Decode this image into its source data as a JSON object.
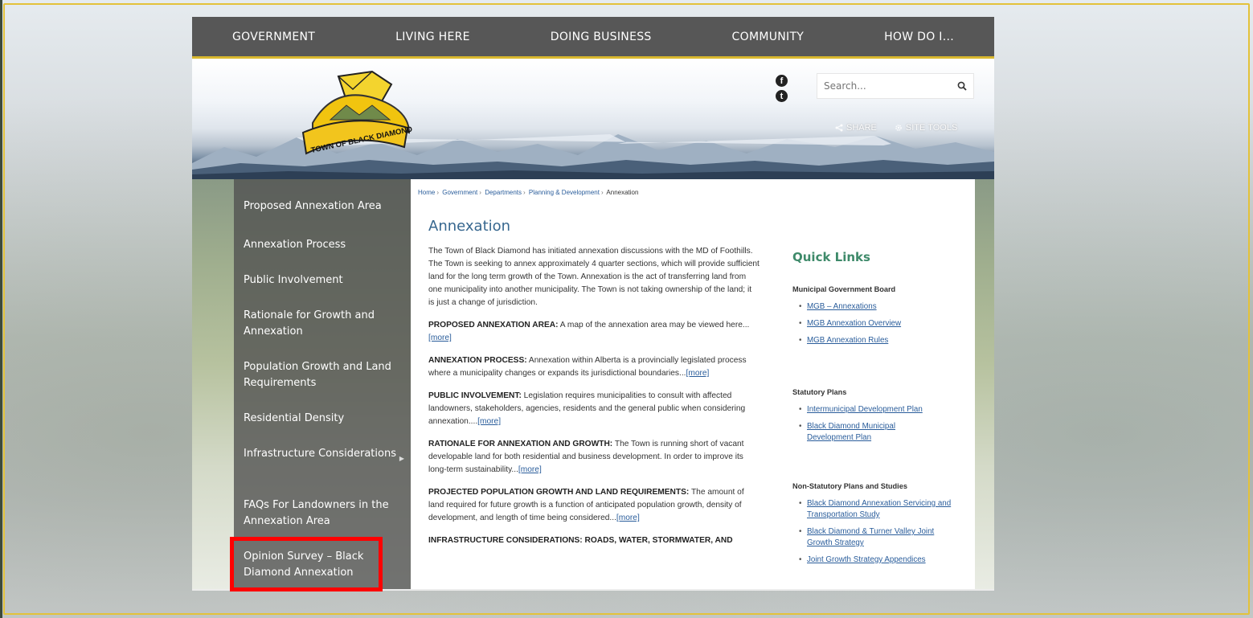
{
  "topnav": {
    "items": [
      "GOVERNMENT",
      "LIVING HERE",
      "DOING BUSINESS",
      "COMMUNITY",
      "HOW DO I..."
    ]
  },
  "header": {
    "logo_text": "TOWN OF BLACK DIAMOND",
    "search_placeholder": "Search...",
    "share_label": "SHARE",
    "site_tools_label": "SITE TOOLS"
  },
  "sidenav": {
    "items": [
      "Proposed Annexation Area",
      "Annexation Process",
      "Public Involvement",
      "Rationale for Growth and Annexation",
      "Population Growth and Land Requirements",
      "Residential Density",
      "Infrastructure Considerations",
      "FAQs For Landowners in the Annexation Area",
      "Opinion Survey – Black Diamond Annexation"
    ]
  },
  "breadcrumb": [
    "Home",
    "Government",
    "Departments",
    "Planning & Development",
    "Annexation"
  ],
  "main": {
    "title": "Annexation",
    "intro": "The Town of Black Diamond has initiated annexation discussions with the MD of Foothills. The Town is seeking to annex approximately 4 quarter sections, which will provide sufficient land for the long term growth of the Town. Annexation is the act of transferring land from one municipality into another municipality. The Town is not taking ownership of the land; it is just a change of jurisdiction.",
    "more": "[more]",
    "sections": [
      {
        "heading": "PROPOSED ANNEXATION AREA:",
        "text": " A map of the annexation area may be viewed here..."
      },
      {
        "heading": "ANNEXATION PROCESS:",
        "text": " Annexation within Alberta is a provincially legislated process where a municipality changes or expands its jurisdictional boundaries..."
      },
      {
        "heading": "PUBLIC INVOLVEMENT:",
        "text": " Legislation requires municipalities to consult with affected landowners, stakeholders, agencies, residents and the general public when considering annexation...."
      },
      {
        "heading": "RATIONALE FOR ANNEXATION AND GROWTH:",
        "text": " The Town is running short of vacant developable land for both residential and business development. In order to improve its long-term sustainability..."
      },
      {
        "heading": "PROJECTED POPULATION GROWTH AND LAND REQUIREMENTS:",
        "text": " The amount of land required for future growth is a function of anticipated population growth, density of development, and length of time being considered..."
      },
      {
        "heading": "INFRASTRUCTURE CONSIDERATIONS: ROADS, WATER, STORMWATER, AND",
        "text": ""
      }
    ]
  },
  "quick_links": {
    "title": "Quick Links",
    "groups": [
      {
        "heading": "Municipal Government Board",
        "links": [
          "MGB – Annexations",
          "MGB Annexation Overview",
          "MGB Annexation Rules"
        ]
      },
      {
        "heading": "Statutory Plans",
        "links": [
          "Intermunicipal Development Plan",
          "Black Diamond Municipal Development Plan"
        ]
      },
      {
        "heading": "Non-Statutory Plans and Studies",
        "links": [
          "Black Diamond Annexation Servicing and Transportation Study",
          "Black Diamond & Turner Valley Joint Growth Strategy",
          "Joint Growth Strategy Appendices"
        ]
      }
    ]
  },
  "colors": {
    "nav_bg": "#575757",
    "accent_gold": "#d9b82e",
    "link_blue": "#2a5d9b",
    "quick_links_green": "#3e8a6a",
    "highlight_red": "#ff0000"
  }
}
